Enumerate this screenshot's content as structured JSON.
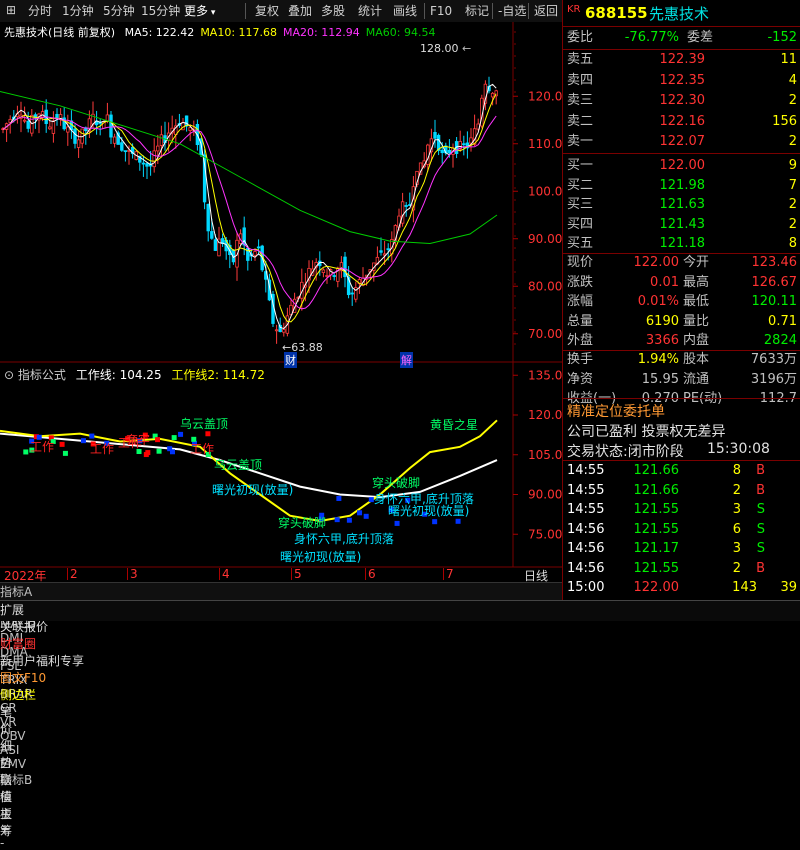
{
  "toolbar": {
    "items": [
      "分时",
      "1分钟",
      "5分钟",
      "15分钟",
      "更多",
      "复权",
      "叠加",
      "多股",
      "统计",
      "画线",
      "F10",
      "标记",
      "-自选",
      "返回"
    ],
    "selected": "更多"
  },
  "main_chart": {
    "title": "先惠技术(日线 前复权)",
    "ma_labels": [
      "MA5: 122.42",
      "MA10: 117.68",
      "MA20: 112.94",
      "MA60: 94.54"
    ],
    "ma_colors": [
      "#ffffff",
      "#ffff00",
      "#ff33ff",
      "#00cc00"
    ],
    "high_marker": "128.00",
    "low_marker": "63.88",
    "event_tags": [
      "财",
      "解"
    ],
    "y_ticks": [
      "120.0",
      "110.0",
      "100.0",
      "90.00",
      "80.00",
      "70.00"
    ]
  },
  "indicator": {
    "name": "指标公式",
    "line1": "工作线: 104.25",
    "line2": "工作线2: 114.72",
    "y_ticks": [
      "135.0",
      "120.0",
      "105.0",
      "90.00",
      "75.00"
    ],
    "annotations": [
      {
        "text": "乌云盖顶",
        "color": "#00ff66"
      },
      {
        "text": "乌云盖顶",
        "color": "#00ff66"
      },
      {
        "text": "黄昏之星",
        "color": "#00ff66"
      },
      {
        "text": "曙光初现(放量)",
        "color": "#00e0ff"
      },
      {
        "text": "穿头破脚",
        "color": "#00ff66"
      },
      {
        "text": "穿头破脚",
        "color": "#00ff66"
      },
      {
        "text": "身怀六甲,底升顶落",
        "color": "#00e0ff"
      },
      {
        "text": "身怀六甲,底升顶落",
        "color": "#00e0ff"
      },
      {
        "text": "曙光初现(放量)",
        "color": "#00e0ff"
      },
      {
        "text": "曙光初现(放量)",
        "color": "#00e0ff"
      },
      {
        "text": "工作",
        "color": "#ff2222"
      },
      {
        "text": "工作",
        "color": "#ff2222"
      },
      {
        "text": "工作",
        "color": "#ff2222"
      },
      {
        "text": "工作",
        "color": "#ff2222"
      },
      {
        "text": "套牢",
        "color": "#ff2222"
      }
    ]
  },
  "x_axis": {
    "labels": [
      "2022年",
      "2",
      "3",
      "4",
      "5",
      "6",
      "7"
    ],
    "period": "日线"
  },
  "tabs": [
    "指标A",
    "窗口",
    "MACD",
    "DMI",
    "DMA",
    "FSL",
    "TRIX",
    "BRAR",
    "CR",
    "VR",
    "OBV",
    "ASI",
    "EMV"
  ],
  "tabs_right": [
    "指标B",
    "模",
    "板",
    "+",
    "-"
  ],
  "status_bar": {
    "items": [
      "扩展",
      "关联报价",
      "财富圈",
      "新用户福利专享",
      "图文F10",
      "侧边栏"
    ],
    "right": [
      "笔",
      "价",
      "细",
      "势",
      "联",
      "值",
      "主",
      "筹"
    ]
  },
  "quote": {
    "market_tag": "KR",
    "code": "688155",
    "name": "先惠技术",
    "weibi_label": "委比",
    "weibi": "-76.77%",
    "weicha_label": "委差",
    "weicha": "-152",
    "asks": [
      {
        "label": "卖五",
        "price": "122.39",
        "vol": "11"
      },
      {
        "label": "卖四",
        "price": "122.35",
        "vol": "4"
      },
      {
        "label": "卖三",
        "price": "122.30",
        "vol": "2"
      },
      {
        "label": "卖二",
        "price": "122.16",
        "vol": "156"
      },
      {
        "label": "卖一",
        "price": "122.07",
        "vol": "2"
      }
    ],
    "bids": [
      {
        "label": "买一",
        "price": "122.00",
        "vol": "9"
      },
      {
        "label": "买二",
        "price": "121.98",
        "vol": "7"
      },
      {
        "label": "买三",
        "price": "121.63",
        "vol": "2"
      },
      {
        "label": "买四",
        "price": "121.43",
        "vol": "2"
      },
      {
        "label": "买五",
        "price": "121.18",
        "vol": "8"
      }
    ],
    "stats": [
      {
        "l1": "现价",
        "v1": "122.00",
        "l2": "今开",
        "v2": "123.46",
        "c1": "red",
        "c2": "red"
      },
      {
        "l1": "涨跌",
        "v1": "0.01",
        "l2": "最高",
        "v2": "126.67",
        "c1": "red",
        "c2": "red"
      },
      {
        "l1": "涨幅",
        "v1": "0.01%",
        "l2": "最低",
        "v2": "120.11",
        "c1": "red",
        "c2": "grn"
      },
      {
        "l1": "总量",
        "v1": "6190",
        "l2": "量比",
        "v2": "0.71",
        "c1": "yel",
        "c2": "yel"
      },
      {
        "l1": "外盘",
        "v1": "3366",
        "l2": "内盘",
        "v2": "2824",
        "c1": "red",
        "c2": "grn"
      }
    ],
    "stats2": [
      {
        "l1": "换手",
        "v1": "1.94%",
        "l2": "股本",
        "v2": "7633万"
      },
      {
        "l1": "净资",
        "v1": "15.95",
        "l2": "流通",
        "v2": "3196万"
      },
      {
        "l1": "收益(一)",
        "v1": "0.270",
        "l2": "PE(动)",
        "v2": "112.7"
      }
    ],
    "promo": "精准定位委托单",
    "company": "公司已盈利 投票权无差异",
    "trade_state_label": "交易状态:闭市阶段",
    "trade_time": "15:30:08",
    "ticks": [
      {
        "t": "14:55",
        "p": "121.66",
        "v": "8",
        "bs": "B"
      },
      {
        "t": "14:55",
        "p": "121.66",
        "v": "2",
        "bs": "B"
      },
      {
        "t": "14:55",
        "p": "121.55",
        "v": "3",
        "bs": "S"
      },
      {
        "t": "14:56",
        "p": "121.55",
        "v": "6",
        "bs": "S"
      },
      {
        "t": "14:56",
        "p": "121.17",
        "v": "3",
        "bs": "S"
      },
      {
        "t": "14:56",
        "p": "121.55",
        "v": "2",
        "bs": "B"
      },
      {
        "t": "15:00",
        "p": "122.00",
        "v": "143",
        "bs": "39"
      }
    ]
  }
}
